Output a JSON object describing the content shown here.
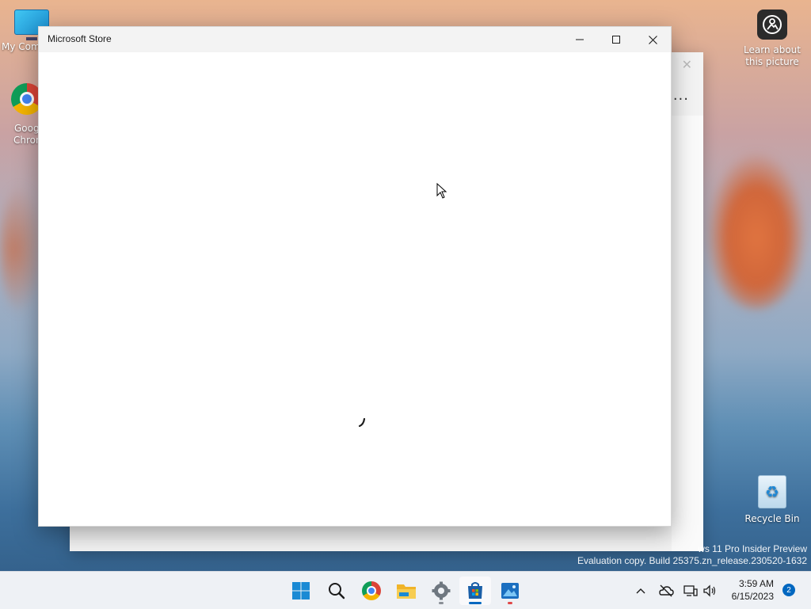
{
  "desktop": {
    "icons": [
      {
        "label": "My Com"
      },
      {
        "label_line1": "Goog",
        "label_line2": "Chron"
      },
      {
        "label_line1": "Learn about",
        "label_line2": "this picture"
      },
      {
        "label": "Recycle Bin"
      }
    ]
  },
  "window": {
    "title": "Microsoft Store",
    "minimize_icon": "minimize-icon",
    "maximize_icon": "maximize-icon",
    "close_icon": "close-icon",
    "loading_icon": "loading-spinner-icon"
  },
  "background_window": {
    "more_label": "...",
    "close_glyph": "✕"
  },
  "watermark": {
    "line1": "ws 11 Pro Insider Preview",
    "line2": "Evaluation copy. Build 25375.zn_release.230520-1632"
  },
  "taskbar": {
    "apps": [
      "start-icon",
      "search-icon",
      "chrome-icon",
      "file-explorer-icon",
      "settings-icon",
      "microsoft-store-icon",
      "photos-icon"
    ],
    "time": "3:59 AM",
    "date": "6/15/2023",
    "notification_count": "2",
    "accent": "#0067c0"
  }
}
